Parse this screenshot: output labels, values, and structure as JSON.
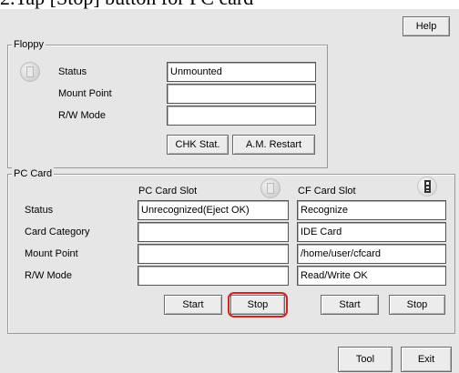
{
  "caption": "2.Tap [Stop] button for PC card",
  "header": {
    "help_label": "Help"
  },
  "floppy": {
    "title": "Floppy",
    "rows": [
      {
        "label": "Status",
        "value": "Unmounted"
      },
      {
        "label": "Mount Point",
        "value": ""
      },
      {
        "label": "R/W Mode",
        "value": ""
      }
    ],
    "chk_stat_label": "CHK Stat.",
    "am_restart_label": "A.M. Restart"
  },
  "pc_card": {
    "title": "PC Card",
    "pc_slot_header": "PC Card Slot",
    "cf_slot_header": "CF Card Slot",
    "rows": [
      {
        "label": "Status",
        "pc_value": "Unrecognized(Eject OK)",
        "cf_value": "Recognize"
      },
      {
        "label": "Card Category",
        "pc_value": "",
        "cf_value": "IDE Card"
      },
      {
        "label": "Mount Point",
        "pc_value": "",
        "cf_value": "/home/user/cfcard"
      },
      {
        "label": "R/W Mode",
        "pc_value": "",
        "cf_value": "Read/Write OK"
      }
    ],
    "pc_start_label": "Start",
    "pc_stop_label": "Stop",
    "cf_start_label": "Start",
    "cf_stop_label": "Stop"
  },
  "footer": {
    "tool_label": "Tool",
    "exit_label": "Exit"
  },
  "colors": {
    "highlight": "#d82020",
    "panel": "#e6e6e6"
  },
  "icons": {
    "floppy": "floppy-disk-icon",
    "pc_slot": "pc-card-slot-icon",
    "cf_slot": "cf-card-slot-icon"
  }
}
